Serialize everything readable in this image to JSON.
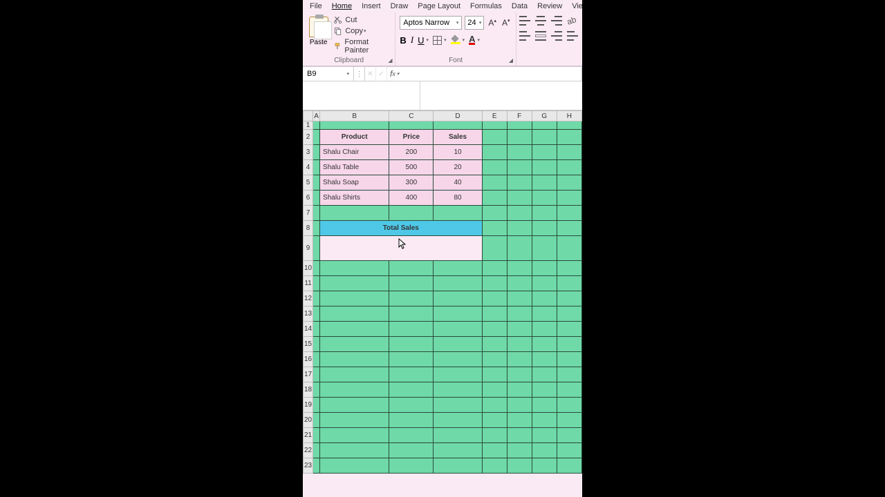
{
  "menu": {
    "items": [
      "File",
      "Home",
      "Insert",
      "Draw",
      "Page Layout",
      "Formulas",
      "Data",
      "Review",
      "View"
    ],
    "active_index": 1
  },
  "ribbon": {
    "clipboard": {
      "paste": "Paste",
      "cut": "Cut",
      "copy": "Copy",
      "format_painter": "Format Painter",
      "group_label": "Clipboard"
    },
    "font": {
      "name": "Aptos Narrow",
      "size": "24",
      "group_label": "Font"
    }
  },
  "name_box": "B9",
  "formula": "",
  "columns": [
    "A",
    "B",
    "C",
    "D",
    "E",
    "F",
    "G",
    "H"
  ],
  "row_count": 23,
  "table": {
    "headers": [
      "Product",
      "Price",
      "Sales"
    ],
    "rows": [
      {
        "product": "Shalu Chair",
        "price": "200",
        "sales": "10"
      },
      {
        "product": "Shalu Table",
        "price": "500",
        "sales": "20"
      },
      {
        "product": "Shalu Soap",
        "price": "300",
        "sales": "40"
      },
      {
        "product": "Shalu Shirts",
        "price": "400",
        "sales": "80"
      }
    ],
    "total_label": "Total Sales"
  },
  "chart_data": {
    "type": "table",
    "title": "Total Sales",
    "columns": [
      "Product",
      "Price",
      "Sales"
    ],
    "rows": [
      [
        "Shalu Chair",
        200,
        10
      ],
      [
        "Shalu Table",
        500,
        20
      ],
      [
        "Shalu Soap",
        300,
        40
      ],
      [
        "Shalu Shirts",
        400,
        80
      ]
    ]
  }
}
